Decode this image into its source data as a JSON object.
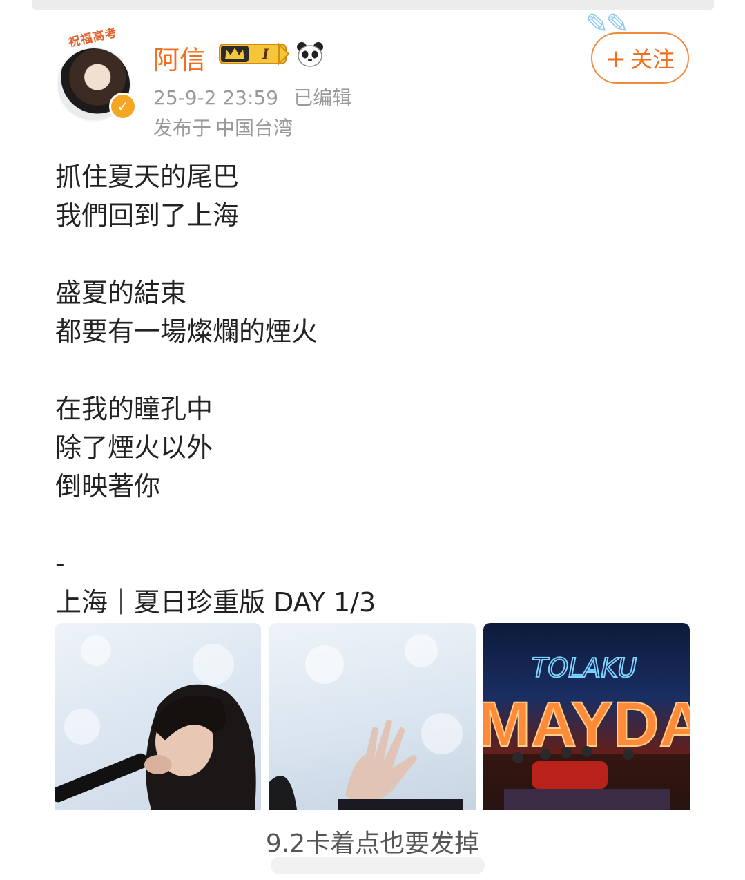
{
  "post": {
    "author": {
      "name": "阿信",
      "avatar_frame_text": "祝福高考",
      "badge_level": "I"
    },
    "follow_label": "关注",
    "follow_plus": "+",
    "timestamp": "25-9-2 23:59",
    "edited": "已编辑",
    "location_prefix": "发布于",
    "location": "中国台湾",
    "lines": [
      "抓住夏天的尾巴",
      "我們回到了上海",
      "",
      "盛夏的結束",
      "都要有一場燦爛的煙火",
      "",
      "在我的瞳孔中",
      "除了煙火以外",
      "倒映著你",
      "",
      "-",
      "上海｜夏日珍重版 DAY 1/3"
    ],
    "photos": [
      {
        "alt": "singer-with-microphone"
      },
      {
        "alt": "raised-hand-in-snow"
      },
      {
        "alt": "mayday-stage",
        "sign_text": "MAYDAY",
        "neon_text": "TOLAKU"
      }
    ]
  },
  "caption": "9.2卡着点也要发掉",
  "colors": {
    "accent": "#f06e1e",
    "meta_gray": "#9a9a9a",
    "verified_gold": "#f5a623"
  }
}
